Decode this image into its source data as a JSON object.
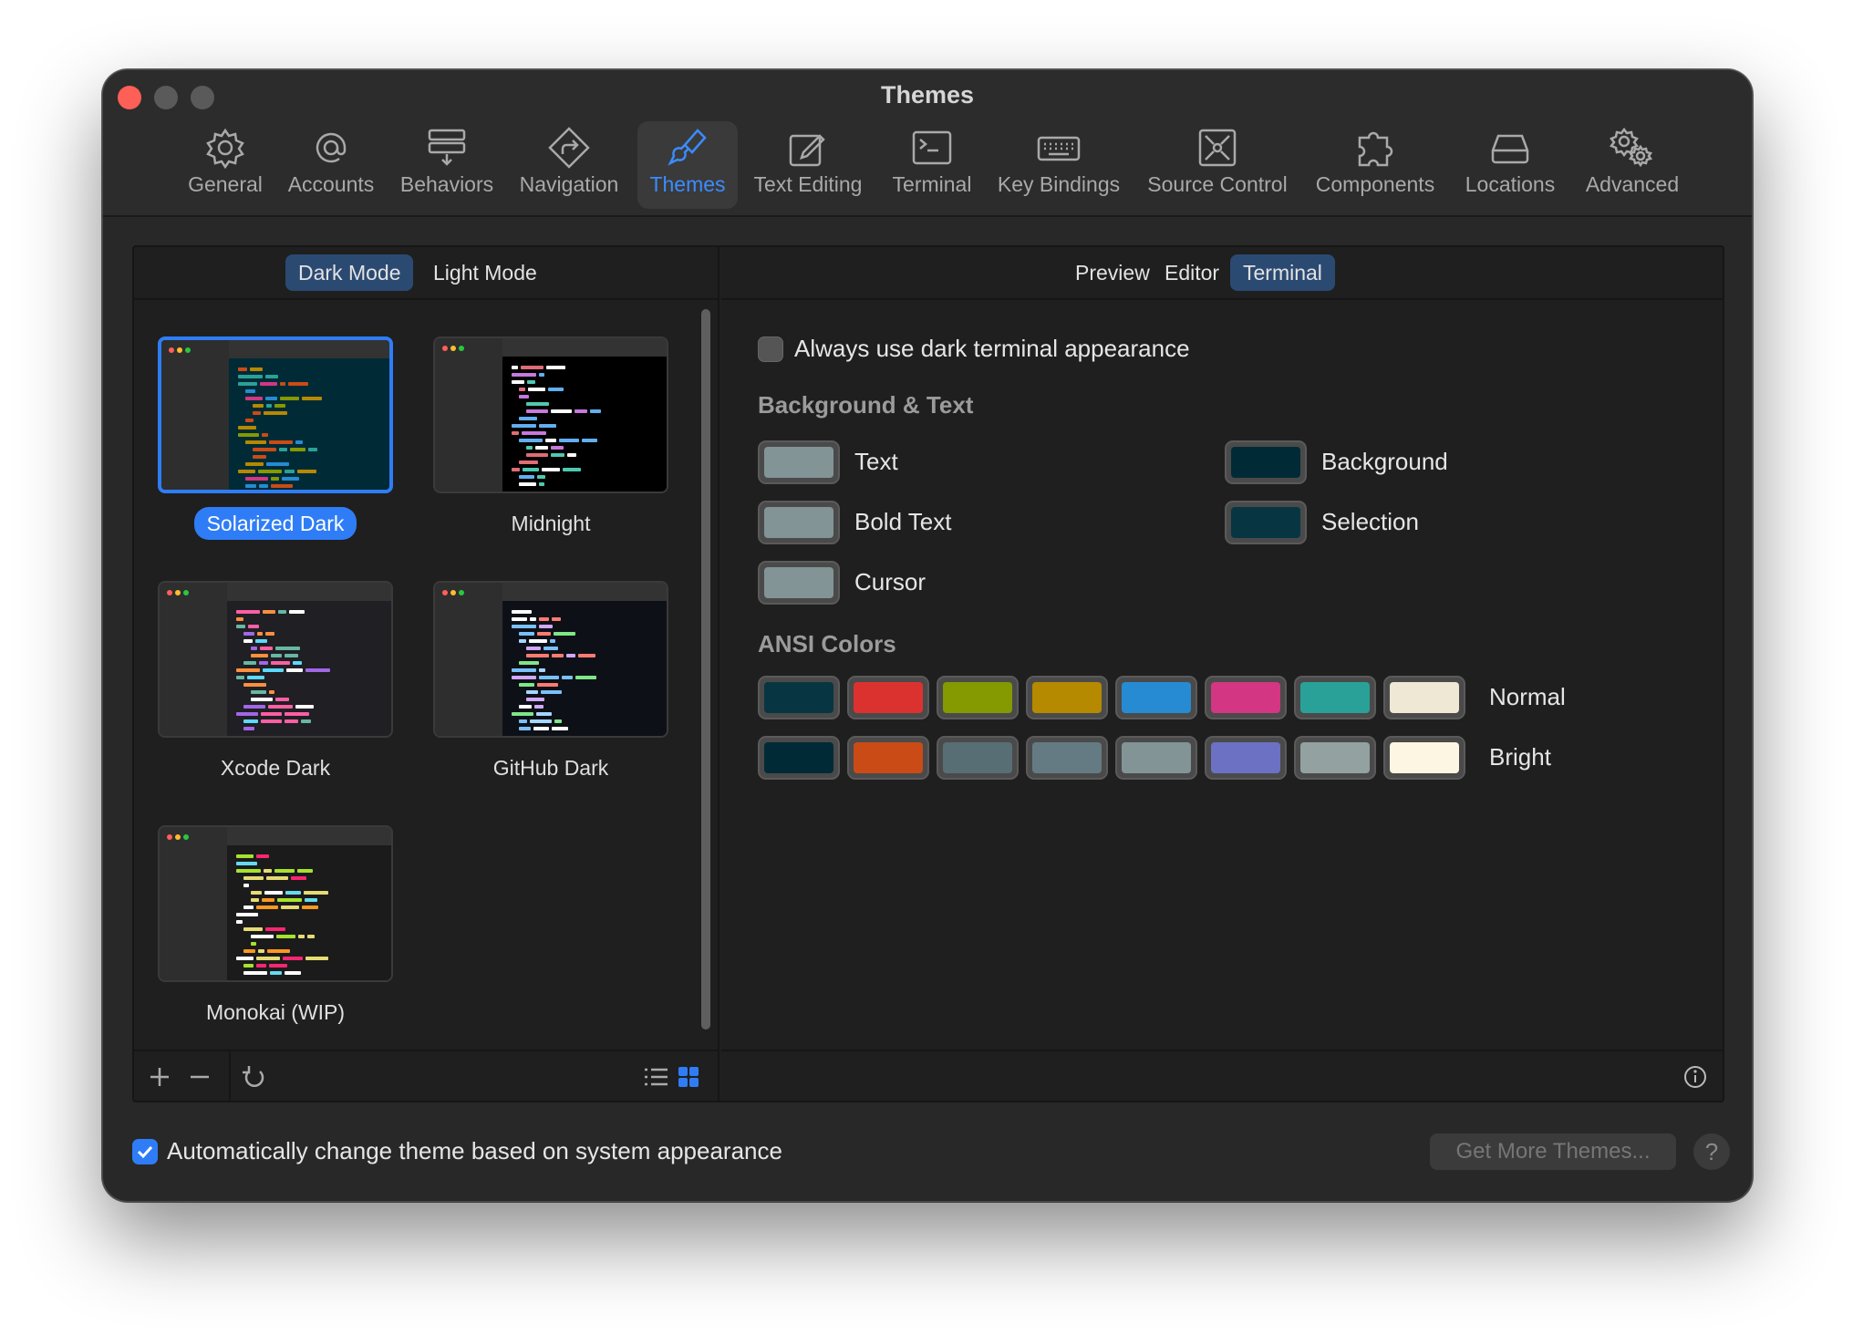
{
  "window": {
    "title": "Themes"
  },
  "toolbar": {
    "items": [
      {
        "label": "General",
        "icon": "gear-icon"
      },
      {
        "label": "Accounts",
        "icon": "at-icon"
      },
      {
        "label": "Behaviors",
        "icon": "behaviors-icon"
      },
      {
        "label": "Navigation",
        "icon": "navigation-icon"
      },
      {
        "label": "Themes",
        "icon": "paintbrush-icon",
        "selected": true
      },
      {
        "label": "Text Editing",
        "icon": "pencil-square-icon"
      },
      {
        "label": "Terminal",
        "icon": "terminal-icon"
      },
      {
        "label": "Key Bindings",
        "icon": "keyboard-icon"
      },
      {
        "label": "Source Control",
        "icon": "source-control-icon"
      },
      {
        "label": "Components",
        "icon": "puzzle-icon"
      },
      {
        "label": "Locations",
        "icon": "drive-icon"
      },
      {
        "label": "Advanced",
        "icon": "gears-icon"
      }
    ]
  },
  "mode_tabs": {
    "dark": "Dark Mode",
    "light": "Light Mode",
    "selected": "dark"
  },
  "themes": [
    {
      "name": "Solarized Dark",
      "selected": true,
      "bg": "#002b36"
    },
    {
      "name": "Midnight",
      "selected": false,
      "bg": "#000000"
    },
    {
      "name": "Xcode Dark",
      "selected": false,
      "bg": "#1f1f24"
    },
    {
      "name": "GitHub Dark",
      "selected": false,
      "bg": "#0d1117"
    },
    {
      "name": "Monokai (WIP)",
      "selected": false,
      "bg": "#1b1b1b"
    }
  ],
  "view_tabs": {
    "preview": "Preview",
    "editor": "Editor",
    "terminal": "Terminal",
    "selected": "terminal"
  },
  "terminal": {
    "always_dark_label": "Always use dark terminal appearance",
    "always_dark_checked": false,
    "bg_text_title": "Background & Text",
    "colors": {
      "text": {
        "label": "Text",
        "color": "#839496"
      },
      "bold_text": {
        "label": "Bold Text",
        "color": "#839496"
      },
      "cursor": {
        "label": "Cursor",
        "color": "#839496"
      },
      "background": {
        "label": "Background",
        "color": "#002b36"
      },
      "selection": {
        "label": "Selection",
        "color": "#073642"
      }
    },
    "ansi_title": "ANSI Colors",
    "normal_label": "Normal",
    "bright_label": "Bright",
    "normal": [
      "#073642",
      "#dc322f",
      "#859900",
      "#b58900",
      "#268bd2",
      "#d33682",
      "#2aa198",
      "#eee8d5"
    ],
    "bright": [
      "#002b36",
      "#cb4b16",
      "#586e75",
      "#657b83",
      "#839496",
      "#6c71c4",
      "#93a1a1",
      "#fdf6e3"
    ]
  },
  "footer": {
    "auto_change_label": "Automatically change theme based on system appearance",
    "auto_change_checked": true,
    "get_more": "Get More Themes...",
    "help": "?"
  },
  "accent": "#2f7df6"
}
